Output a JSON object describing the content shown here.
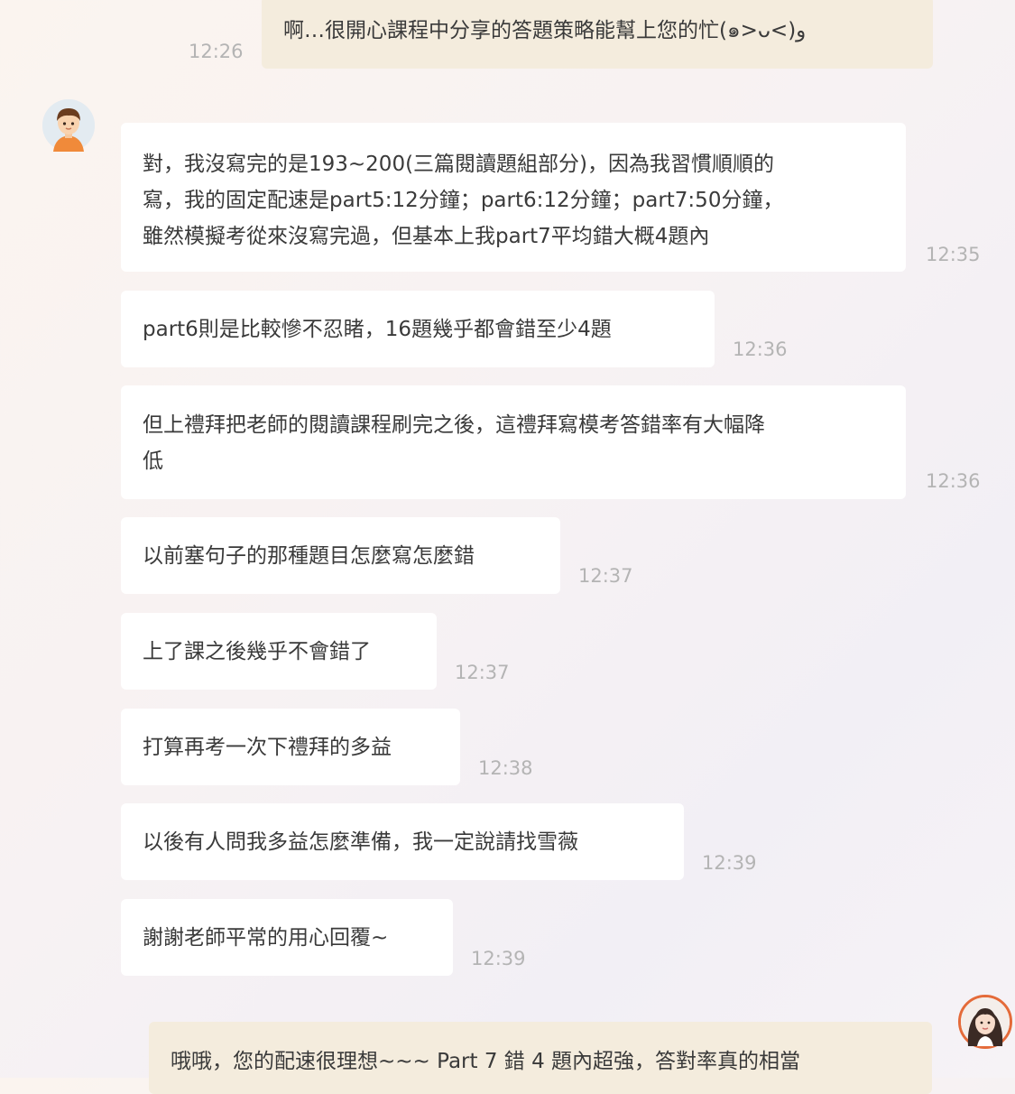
{
  "messages": [
    {
      "text": "啊…很開心課程中分享的答題策略能幫上您的忙(๑>ᴗ<)و",
      "time": "12:26",
      "from": "teacher"
    },
    {
      "text": "對，我沒寫完的是193~200(三篇閱讀題組部分)，因為我習慣順順的\n寫，我的固定配速是part5:12分鐘；part6:12分鐘；part7:50分鐘，\n雖然模擬考從來沒寫完過，但基本上我part7平均錯大概4題內",
      "time": "12:35",
      "from": "student"
    },
    {
      "text": "part6則是比較慘不忍睹，16題幾乎都會錯至少4題",
      "time": "12:36",
      "from": "student"
    },
    {
      "text": "但上禮拜把老師的閱讀課程刷完之後，這禮拜寫模考答錯率有大幅降\n低",
      "time": "12:36",
      "from": "student"
    },
    {
      "text": "以前塞句子的那種題目怎麼寫怎麼錯",
      "time": "12:37",
      "from": "student"
    },
    {
      "text": "上了課之後幾乎不會錯了",
      "time": "12:37",
      "from": "student"
    },
    {
      "text": "打算再考一次下禮拜的多益",
      "time": "12:38",
      "from": "student"
    },
    {
      "text": "以後有人問我多益怎麼準備，我一定說請找雪薇",
      "time": "12:39",
      "from": "student"
    },
    {
      "text": "謝謝老師平常的用心回覆~",
      "time": "12:39",
      "from": "student"
    },
    {
      "text": "哦哦，您的配速很理想~~~ Part 7 錯 4 題內超強，答對率真的相當",
      "from": "teacher"
    }
  ],
  "avatars": {
    "student": "boy-avatar-icon",
    "teacher": "girl-avatar-icon"
  },
  "colors": {
    "incoming_bubble": "#ffffff",
    "outgoing_bubble": "#f4ecdd",
    "timestamp": "#b4b4b4"
  }
}
